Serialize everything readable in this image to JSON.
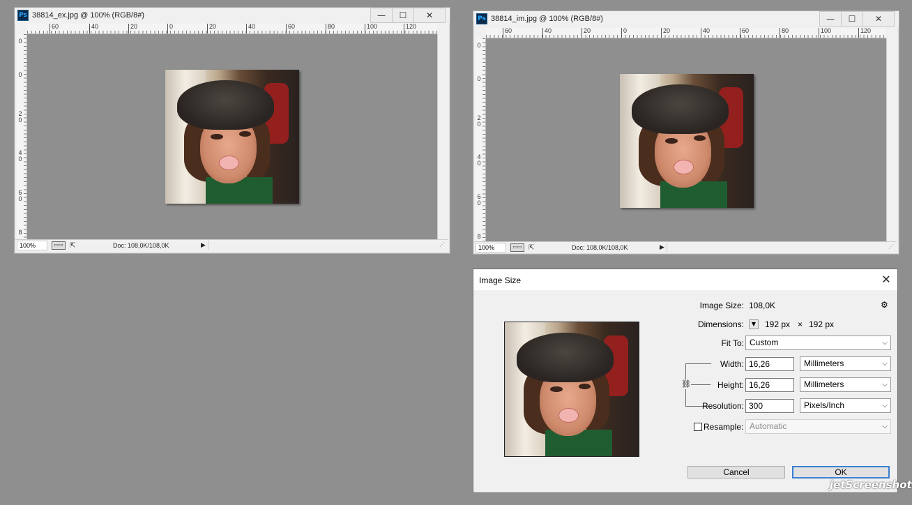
{
  "windows": [
    {
      "title": "38814_ex.jpg @ 100% (RGB/8#)",
      "ruler_h": [
        "60",
        "40",
        "20",
        "0",
        "20",
        "40",
        "60",
        "80",
        "100",
        "120"
      ],
      "ruler_v": [
        "0",
        "0",
        "2\n0",
        "4\n0",
        "6\n0",
        "8"
      ],
      "zoom": "100%",
      "doc_size": "Doc: 108,0K/108,0K"
    },
    {
      "title": "38814_im.jpg @ 100% (RGB/8#)",
      "ruler_h": [
        "60",
        "40",
        "20",
        "0",
        "20",
        "40",
        "60",
        "80",
        "100",
        "120"
      ],
      "ruler_v": [
        "0",
        "0",
        "2\n0",
        "4\n0",
        "6\n0",
        "8"
      ],
      "zoom": "100%",
      "doc_size": "Doc: 108,0K/108,0K"
    }
  ],
  "window_buttons": {
    "minimize": "—",
    "maximize": "☐",
    "close": "✕"
  },
  "ps_icon_label": "Ps",
  "dialog": {
    "title": "Image Size",
    "close": "✕",
    "image_size_label": "Image Size:",
    "image_size_value": "108,0K",
    "gear": "⚙",
    "dimensions_label": "Dimensions:",
    "dimensions_w": "192 px",
    "dimensions_x": "×",
    "dimensions_h": "192 px",
    "fit_to_label": "Fit To:",
    "fit_to_value": "Custom",
    "width_label": "Width:",
    "width_value": "16,26",
    "width_unit": "Millimeters",
    "height_label": "Height:",
    "height_value": "16,26",
    "height_unit": "Millimeters",
    "resolution_label": "Resolution:",
    "resolution_value": "300",
    "resolution_unit": "Pixels/Inch",
    "resample_label": "Resample:",
    "resample_checked": false,
    "resample_value": "Automatic",
    "cancel_label": "Cancel",
    "ok_label": "OK"
  },
  "watermark": "jetScreenshot"
}
